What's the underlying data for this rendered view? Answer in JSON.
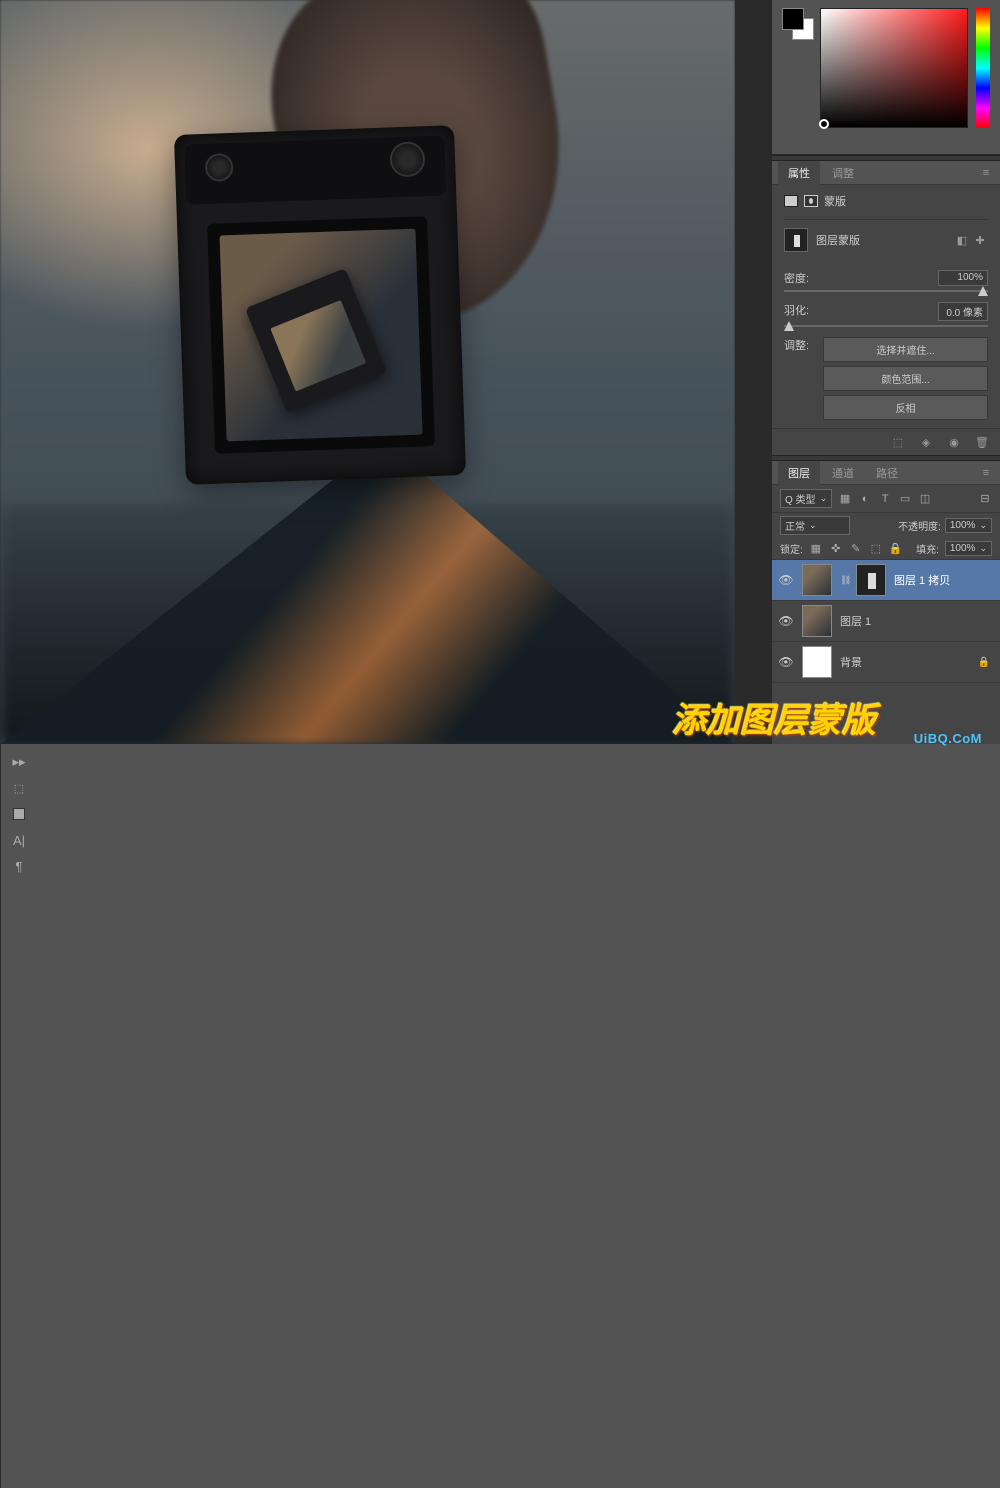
{
  "tabs": {
    "properties": "属性",
    "adjustments": "调整",
    "layers": "图层",
    "channels": "通道",
    "paths": "路径"
  },
  "mask_panel": {
    "title": "蒙版",
    "type_label": "图层蒙版",
    "density_label": "密度:",
    "density_value": "100%",
    "feather_label": "羽化:",
    "feather_value": "0.0 像素",
    "adjust_label": "调整:",
    "btn_select": "选择并遮住...",
    "btn_colorrange": "颜色范围...",
    "btn_invert": "反相"
  },
  "layers_panel": {
    "kind_label": "Q 类型",
    "blend_mode": "正常",
    "opacity_label": "不透明度:",
    "opacity_value": "100%",
    "lock_label": "锁定:",
    "fill_label": "填充:",
    "fill_value": "100%",
    "items": [
      {
        "name": "图层 1 拷贝",
        "has_mask": true,
        "selected": true,
        "locked": false,
        "thumb": "photo"
      },
      {
        "name": "图层 1",
        "has_mask": false,
        "selected": false,
        "locked": false,
        "thumb": "photo"
      },
      {
        "name": "背景",
        "has_mask": false,
        "selected": false,
        "locked": true,
        "thumb": "white"
      }
    ]
  },
  "vtools": {
    "home": "🏠",
    "color": "■",
    "type": "A|",
    "para": "¶"
  },
  "watermark": {
    "main": "添加图层蒙版",
    "sub": "UiBQ.CoM"
  }
}
